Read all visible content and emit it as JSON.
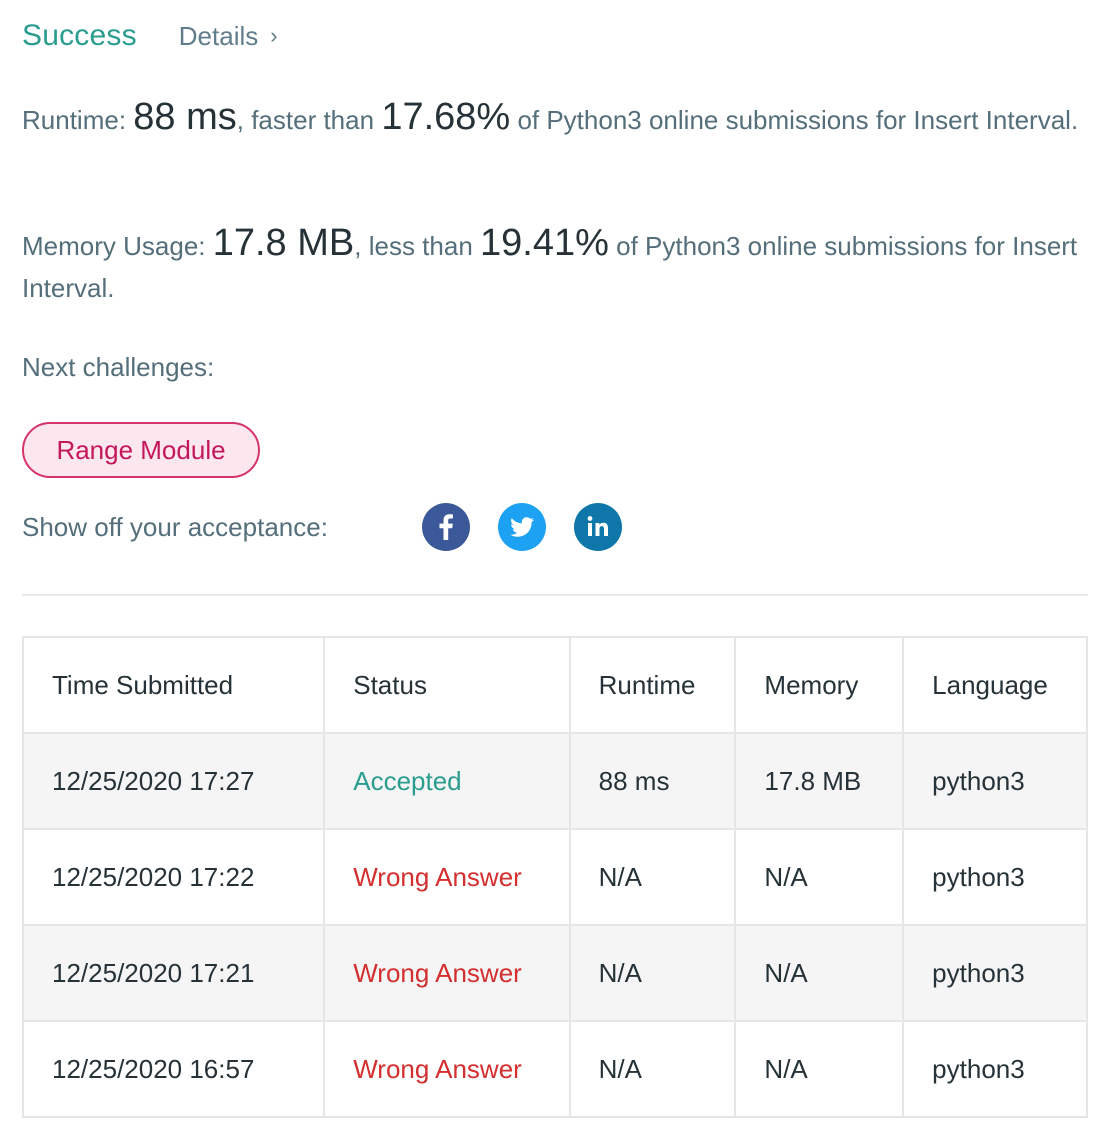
{
  "header": {
    "status": "Success",
    "details_label": "Details",
    "details_chevron": "›"
  },
  "runtime_stat": {
    "label": "Runtime:",
    "value": "88 ms",
    "mid_text": ", faster than",
    "percent": "17.68%",
    "tail_text": "of Python3 online submissions for Insert Interval."
  },
  "memory_stat": {
    "label": "Memory Usage:",
    "value": "17.8 MB",
    "mid_text": ", less than",
    "percent": "19.41%",
    "tail_text": "of Python3 online submissions for Insert Interval."
  },
  "next_challenges": {
    "label": "Next challenges:",
    "items": [
      "Range Module"
    ]
  },
  "share": {
    "label": "Show off your acceptance:",
    "icons": [
      "facebook-icon",
      "twitter-icon",
      "linkedin-icon"
    ],
    "colors": {
      "facebook": "#3b5998",
      "twitter": "#1da1f2",
      "linkedin": "#0e76a8"
    }
  },
  "colors": {
    "success": "#2a9d8f",
    "wrong": "#d32f2f",
    "challenge_border": "#d6336c",
    "challenge_bg": "#fde7ee"
  },
  "submissions": {
    "headers": [
      "Time Submitted",
      "Status",
      "Runtime",
      "Memory",
      "Language"
    ],
    "rows": [
      {
        "time": "12/25/2020 17:27",
        "status": "Accepted",
        "runtime": "88 ms",
        "memory": "17.8 MB",
        "language": "python3"
      },
      {
        "time": "12/25/2020 17:22",
        "status": "Wrong Answer",
        "runtime": "N/A",
        "memory": "N/A",
        "language": "python3"
      },
      {
        "time": "12/25/2020 17:21",
        "status": "Wrong Answer",
        "runtime": "N/A",
        "memory": "N/A",
        "language": "python3"
      },
      {
        "time": "12/25/2020 16:57",
        "status": "Wrong Answer",
        "runtime": "N/A",
        "memory": "N/A",
        "language": "python3"
      }
    ]
  }
}
